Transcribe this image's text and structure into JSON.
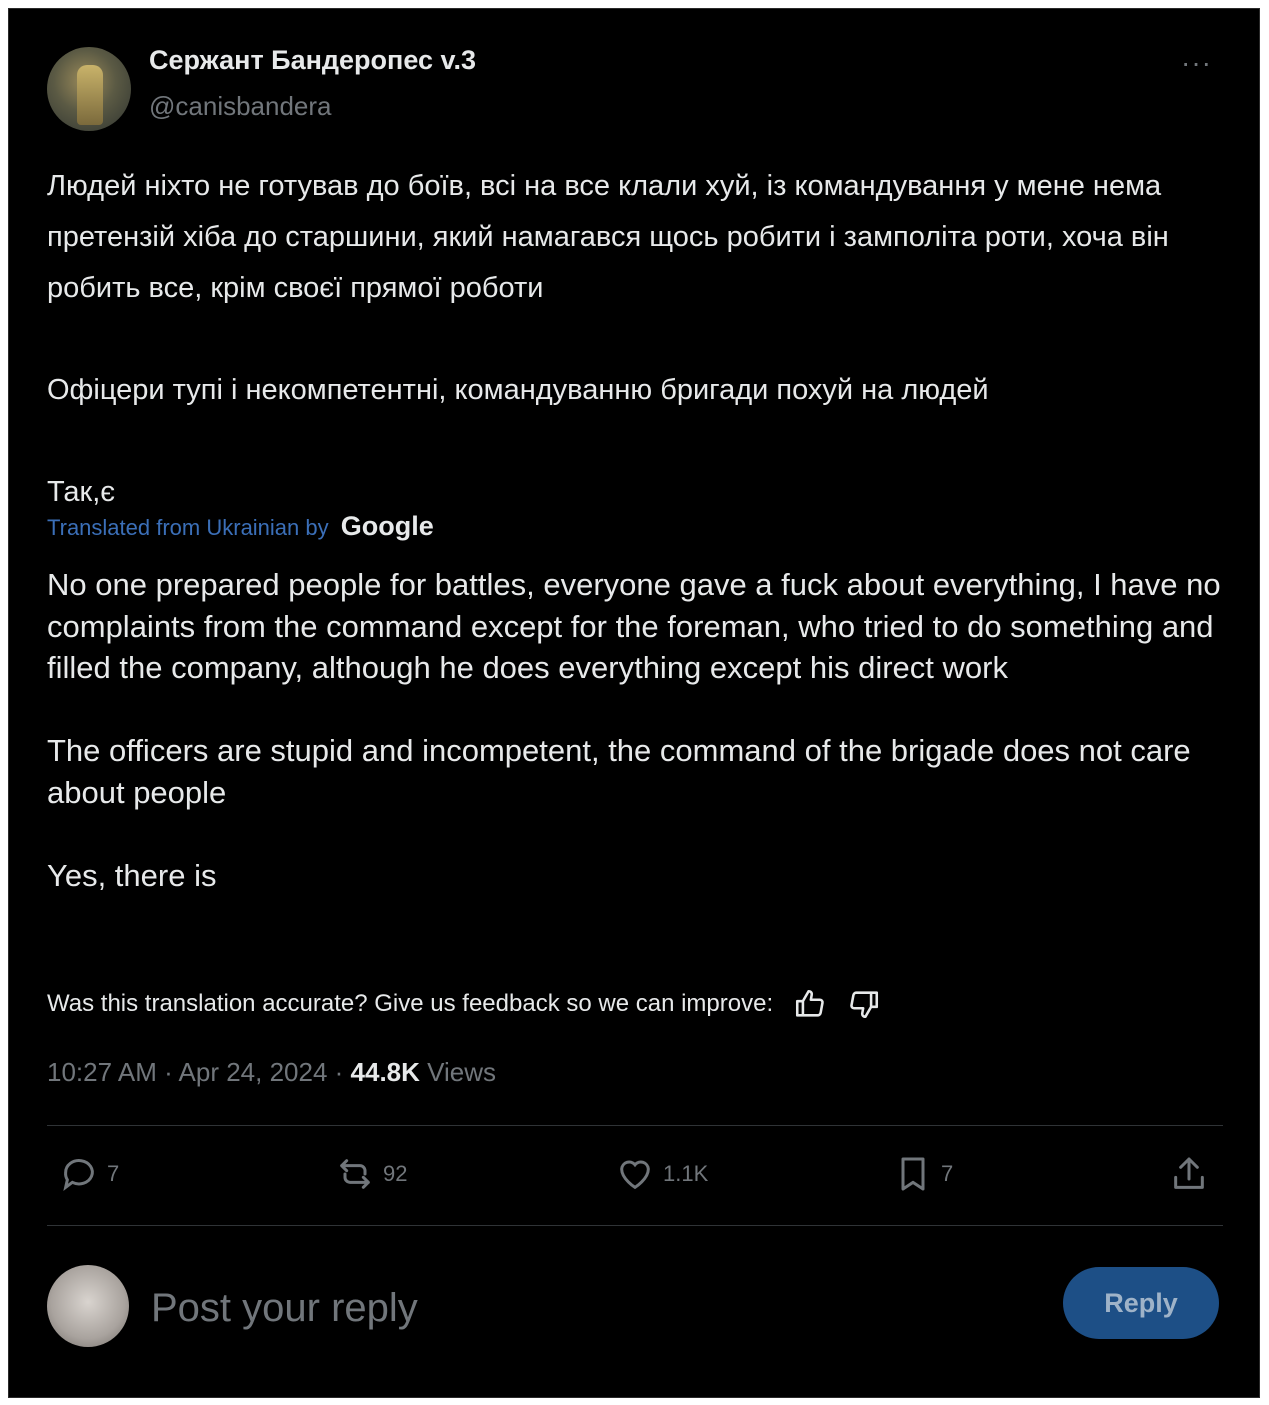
{
  "author": {
    "display_name": "Сержант Бандеропес v.3",
    "handle": "@canisbandera",
    "more_glyph": "···"
  },
  "post": {
    "original_text": "Людей ніхто не готував до боїв, всі на все клали хуй, із командування у мене нема претензій хіба до старшини, який намагався щось робити і замполіта роти, хоча він робить все, крім своєї прямої роботи\n\nОфіцери тупі і некомпетентні, командуванню бригади похуй на людей\n\nТак,є",
    "translated_by_label": "Translated from Ukrainian by",
    "translated_by_provider": "Google",
    "translated_text": "No one prepared people for battles, everyone gave a fuck about everything, I have no complaints from the command except for the foreman, who tried to do something and filled the company, although he does everything except his direct work\n\nThe officers are stupid and incompetent, the command of the brigade does not care about people\n\nYes, there is",
    "feedback_text": "Was this translation accurate? Give us feedback so we can improve:",
    "time": "10:27 AM · Apr 24, 2024 ·",
    "views_count": "44.8K",
    "views_label": "Views"
  },
  "actions": {
    "replies": "7",
    "reposts": "92",
    "likes": "1.1K",
    "bookmarks": "7"
  },
  "reply_box": {
    "placeholder": "Post your reply",
    "button_label": "Reply"
  },
  "colors": {
    "background": "#000000",
    "text": "#e7e9ea",
    "muted": "#71767b",
    "link": "#3b6fb8",
    "reply_button": "#1d4f86"
  }
}
